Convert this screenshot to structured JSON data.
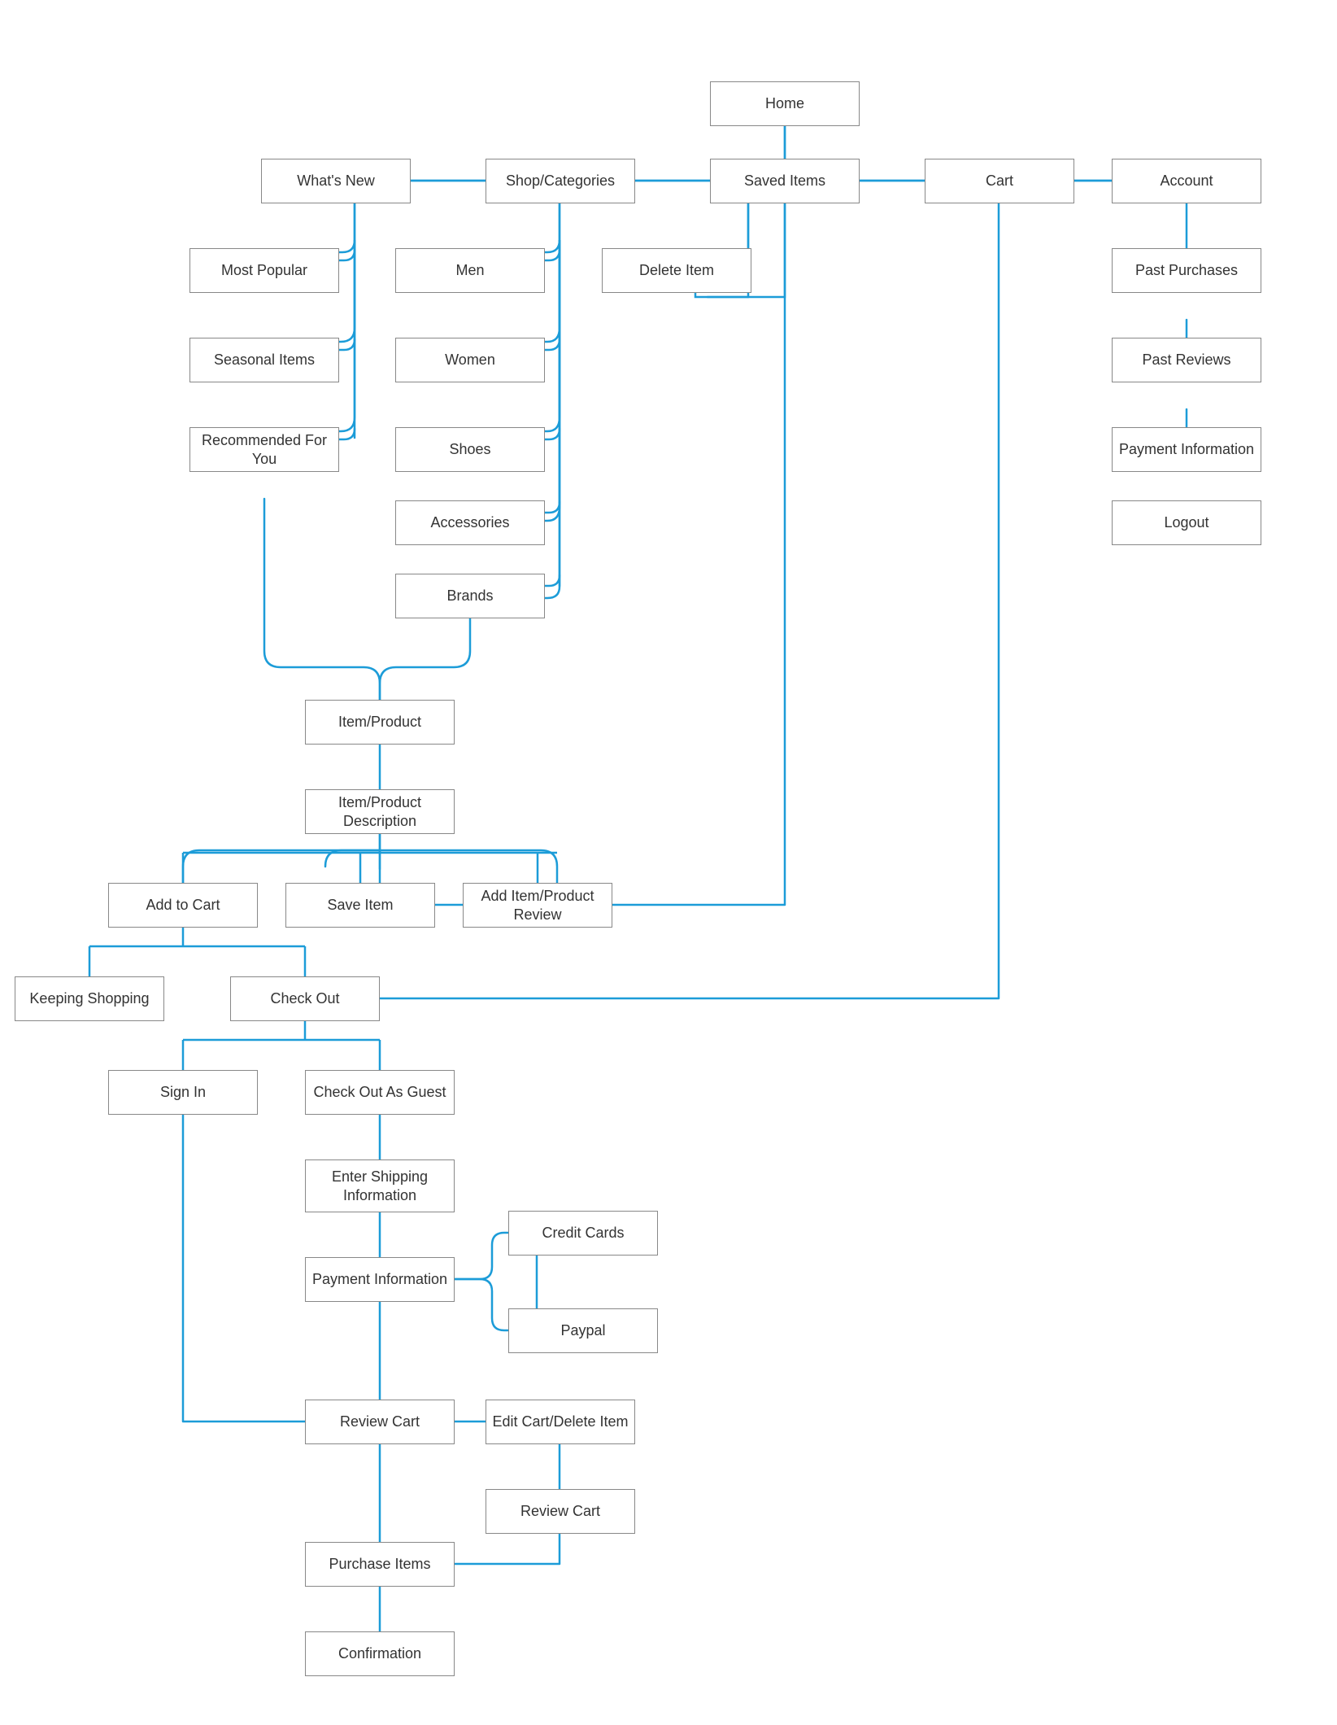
{
  "diagram": {
    "nodes": {
      "home": "Home",
      "whats_new": "What's New",
      "shop_categories": "Shop/Categories",
      "saved_items": "Saved Items",
      "cart": "Cart",
      "account": "Account",
      "most_popular": "Most Popular",
      "seasonal_items": "Seasonal Items",
      "recommended": "Recommended For You",
      "men": "Men",
      "women": "Women",
      "shoes": "Shoes",
      "accessories": "Accessories",
      "brands": "Brands",
      "delete_item": "Delete Item",
      "past_purchases": "Past Purchases",
      "past_reviews": "Past Reviews",
      "payment_info_acct": "Payment Information",
      "logout": "Logout",
      "item_product": "Item/Product",
      "item_description": "Item/Product Description",
      "add_to_cart": "Add to Cart",
      "save_item": "Save Item",
      "add_review": "Add Item/Product Review",
      "keeping_shopping": "Keeping Shopping",
      "check_out": "Check Out",
      "sign_in": "Sign In",
      "check_out_guest": "Check Out As Guest",
      "enter_shipping": "Enter Shipping Information",
      "payment_info": "Payment Information",
      "credit_cards": "Credit Cards",
      "paypal": "Paypal",
      "review_cart": "Review Cart",
      "edit_cart": "Edit Cart/Delete Item",
      "review_cart2": "Review Cart",
      "purchase_items": "Purchase Items",
      "confirmation": "Confirmation"
    },
    "accent_color": "#1c9cd8"
  }
}
